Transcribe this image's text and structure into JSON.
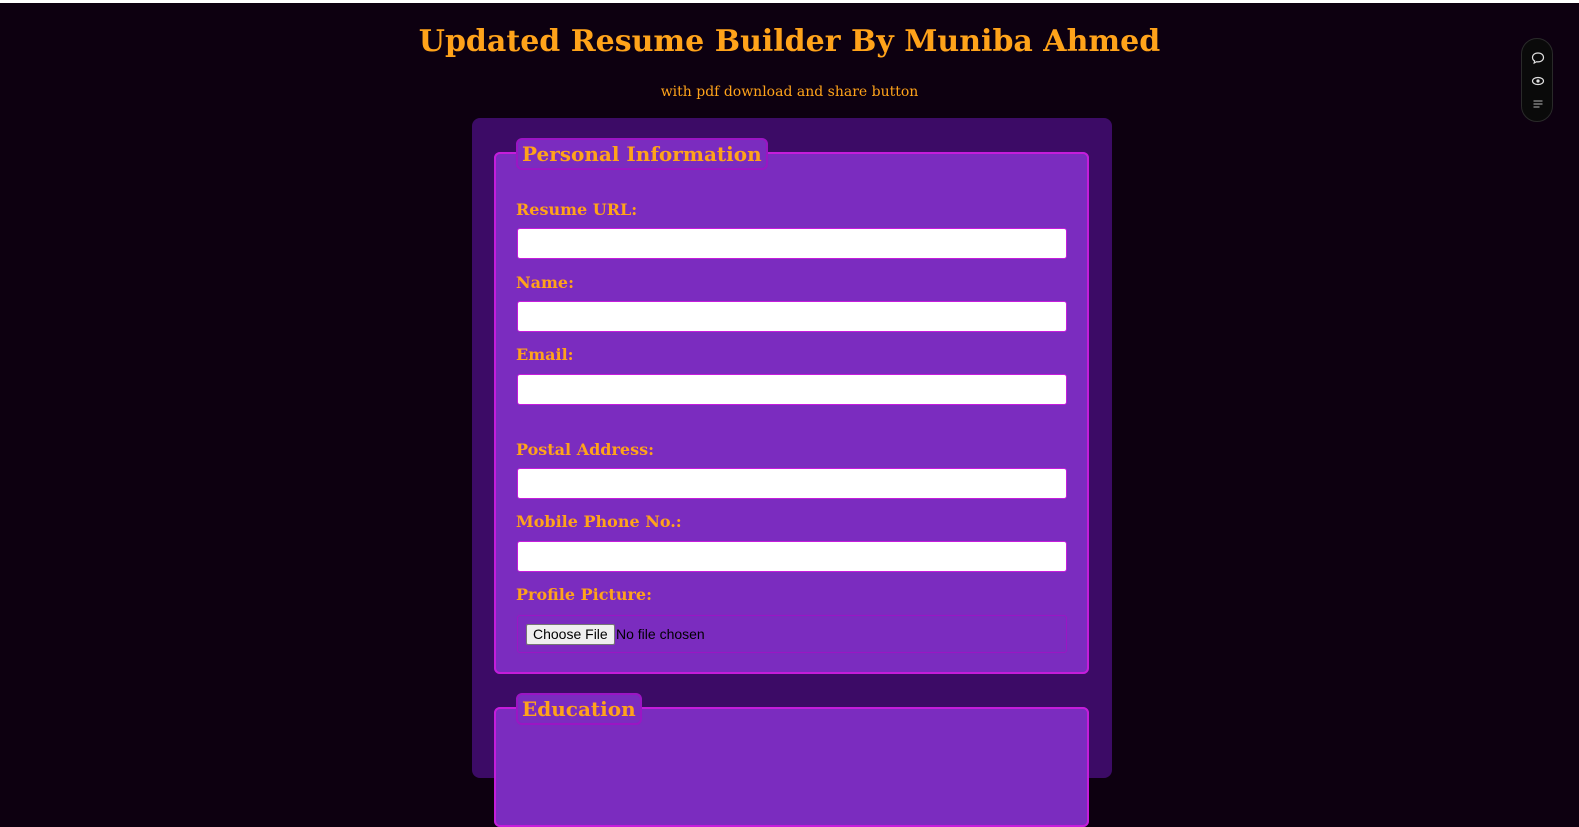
{
  "header": {
    "title": "Updated Resume Builder By Muniba Ahmed",
    "subtitle": "with pdf download and share button"
  },
  "personal": {
    "legend": "Personal Information",
    "fields": [
      {
        "label": "Resume URL:",
        "value": ""
      },
      {
        "label": "Name:",
        "value": ""
      },
      {
        "label": "Email:",
        "value": ""
      },
      {
        "label": "Postal Address:",
        "value": ""
      },
      {
        "label": "Mobile Phone No.:",
        "value": ""
      }
    ],
    "picture": {
      "label": "Profile Picture:",
      "button_label": "Choose File",
      "status": "No file chosen"
    }
  },
  "education": {
    "legend": "Education"
  },
  "toolbar": {
    "icons": [
      "comment-icon",
      "eye-icon",
      "list-icon"
    ]
  },
  "colors": {
    "background": "#0d0010",
    "accent": "#ffa31a",
    "panel": "#3c0b66",
    "fieldset": "#7b2cbf",
    "border": "#c51ddb"
  }
}
